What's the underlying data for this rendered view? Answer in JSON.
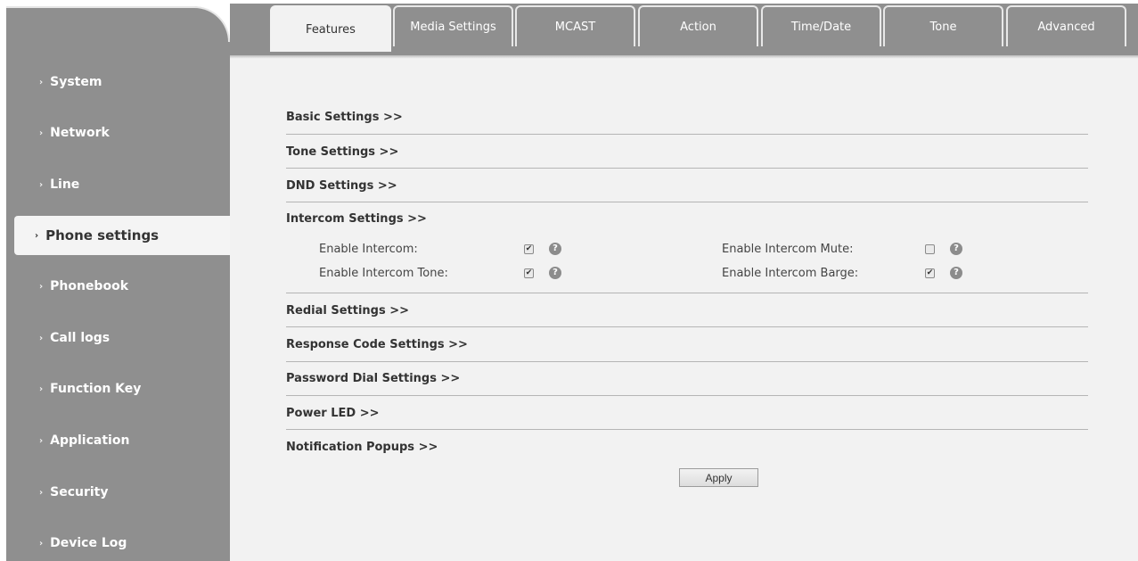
{
  "sidebar": {
    "items": [
      {
        "label": "System",
        "active": false
      },
      {
        "label": "Network",
        "active": false
      },
      {
        "label": "Line",
        "active": false
      },
      {
        "label": "Phone settings",
        "active": true
      },
      {
        "label": "Phonebook",
        "active": false
      },
      {
        "label": "Call logs",
        "active": false
      },
      {
        "label": "Function Key",
        "active": false
      },
      {
        "label": "Application",
        "active": false
      },
      {
        "label": "Security",
        "active": false
      },
      {
        "label": "Device Log",
        "active": false
      }
    ]
  },
  "tabs": [
    {
      "label": "Features",
      "active": true
    },
    {
      "label": "Media Settings",
      "active": false
    },
    {
      "label": "MCAST",
      "active": false
    },
    {
      "label": "Action",
      "active": false
    },
    {
      "label": "Time/Date",
      "active": false
    },
    {
      "label": "Tone",
      "active": false
    },
    {
      "label": "Advanced",
      "active": false
    }
  ],
  "sections": {
    "basic": "Basic Settings >>",
    "tone": "Tone Settings >>",
    "dnd": "DND Settings >>",
    "intercom": "Intercom Settings >>",
    "redial": "Redial Settings >>",
    "response_code": "Response Code Settings >>",
    "password_dial": "Password Dial Settings >>",
    "power_led": "Power LED >>",
    "notification": "Notification Popups >>"
  },
  "intercom": {
    "enable_intercom": {
      "label": "Enable Intercom:",
      "checked": true
    },
    "enable_intercom_tone": {
      "label": "Enable Intercom Tone:",
      "checked": true
    },
    "enable_intercom_mute": {
      "label": "Enable Intercom Mute:",
      "checked": false
    },
    "enable_intercom_barge": {
      "label": "Enable Intercom Barge:",
      "checked": true
    }
  },
  "apply_label": "Apply",
  "icons": {
    "chevron": "chevron-right-icon",
    "help": "help-icon",
    "check_glyph": "✔",
    "help_glyph": "?",
    "chevron_glyph": "›"
  },
  "colors": {
    "sidebar_bg": "#8f8f8f",
    "content_bg": "#f2f2f2",
    "active_tab_bg": "#f2f2f2"
  }
}
